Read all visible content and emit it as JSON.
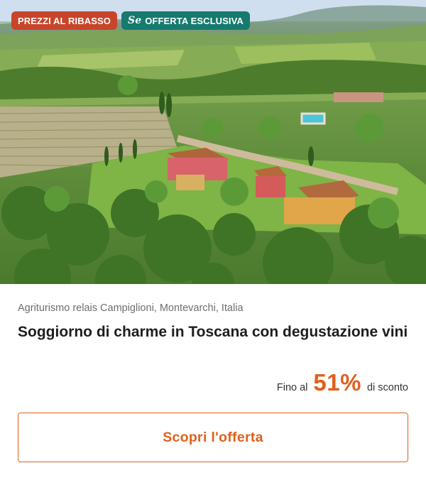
{
  "hero": {
    "image_alt": "Aerial view of Tuscan farmhouse with vineyards and pool"
  },
  "badges": {
    "price_drop": "PREZZI AL RIBASSO",
    "exclusive_logo": "Se",
    "exclusive": "OFFERTA ESCLUSIVA"
  },
  "offer": {
    "location": "Agriturismo relais Campiglioni, Montevarchi, Italia",
    "title": "Soggiorno di charme in Toscana con degustazione vini",
    "discount_prefix": "Fino al",
    "discount_value": "51%",
    "discount_suffix": "di sconto",
    "cta_label": "Scopri l'offerta"
  },
  "colors": {
    "accent": "#e0601c",
    "price_badge": "#c8452a",
    "exclusive_badge": "#167a6e"
  }
}
